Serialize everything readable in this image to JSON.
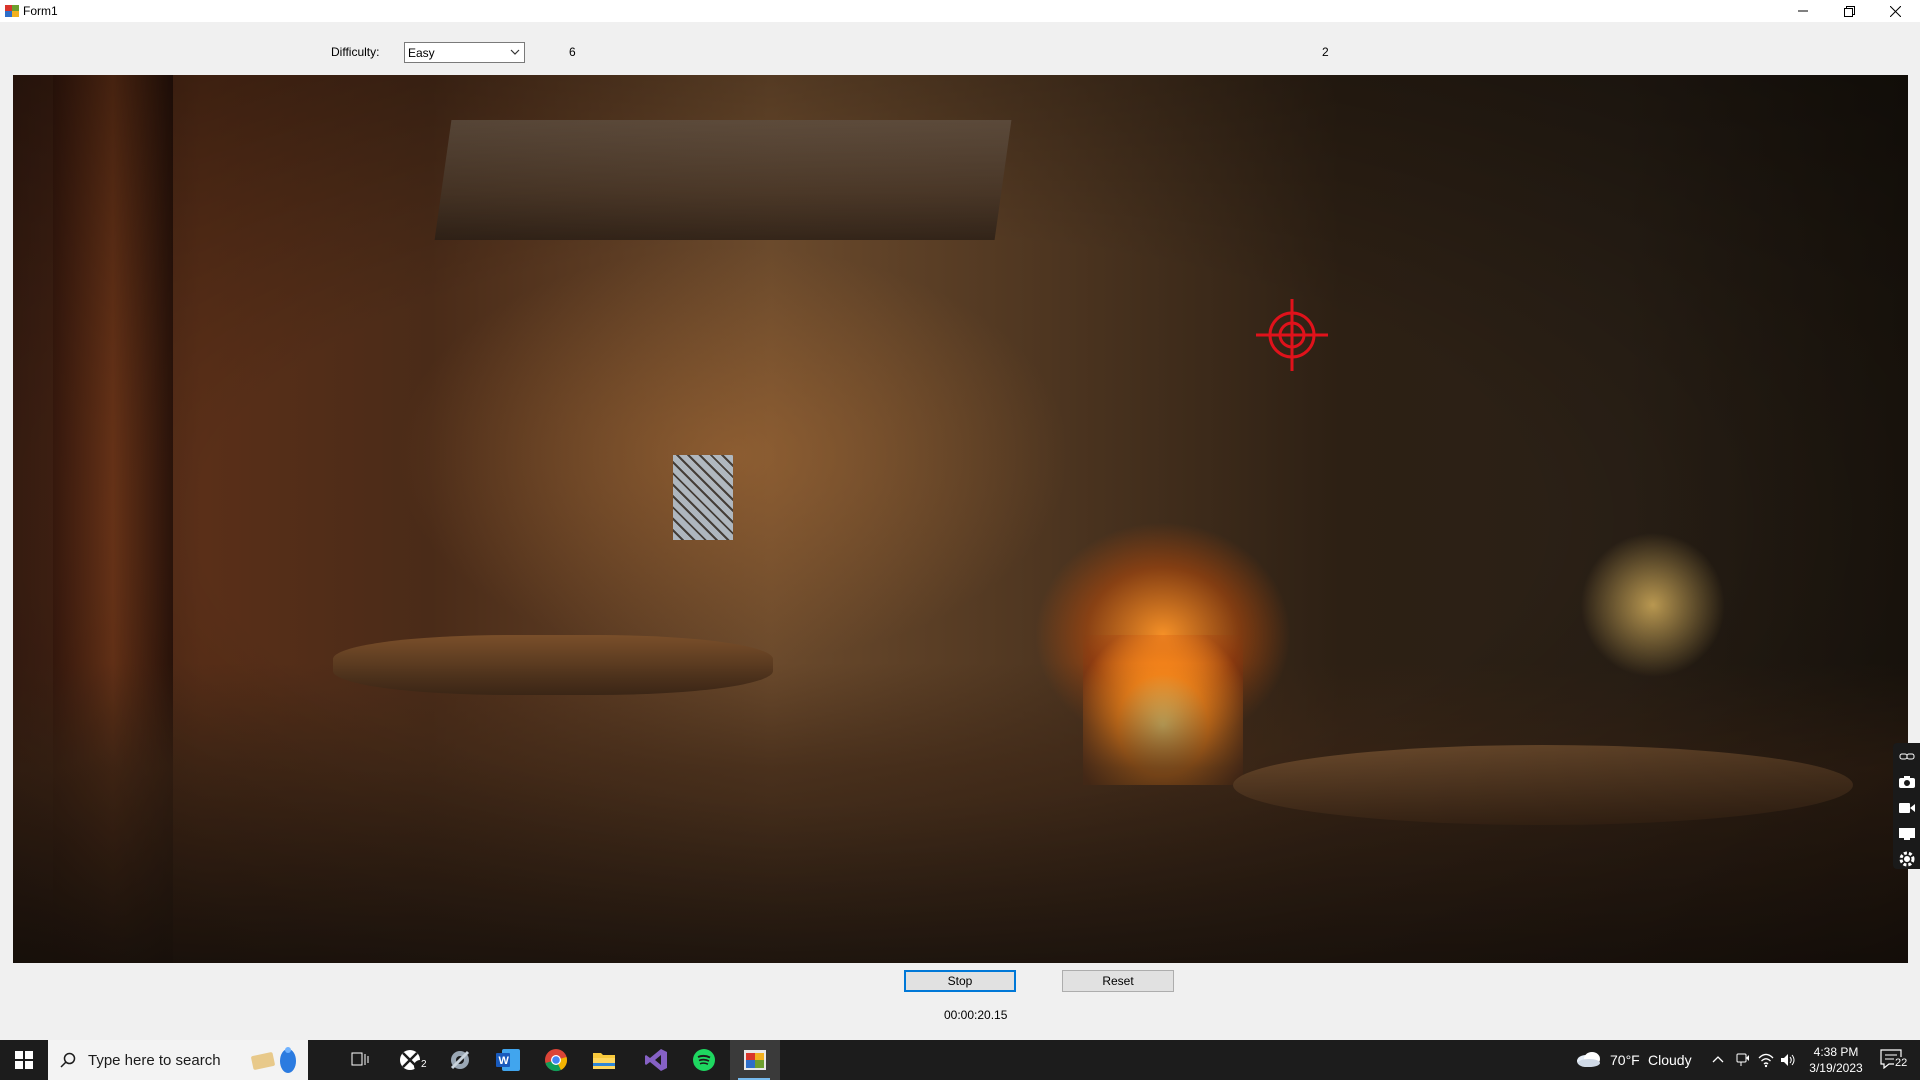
{
  "window": {
    "title": "Form1"
  },
  "controls": {
    "difficulty_label": "Difficulty:",
    "difficulty_selected": "Easy",
    "score_left": "6",
    "score_right": "2"
  },
  "buttons": {
    "stop_label": "Stop",
    "reset_label": "Reset"
  },
  "timer": {
    "elapsed": "00:00:20.15"
  },
  "game": {
    "background_scene": "tavern-interior",
    "target_icon": "crosshair-icon",
    "target_color": "#e0121b"
  },
  "side_toolbar": {
    "icons": [
      "link-icon",
      "camera-icon",
      "video-icon",
      "screen-icon",
      "gear-icon"
    ]
  },
  "taskbar": {
    "search_placeholder": "Type here to search",
    "xbox_badge": "2",
    "weather_temp": "70°F",
    "weather_desc": "Cloudy",
    "time": "4:38 PM",
    "date": "3/19/2023",
    "notification_count": "22",
    "accent_color": "#76b9ed"
  }
}
